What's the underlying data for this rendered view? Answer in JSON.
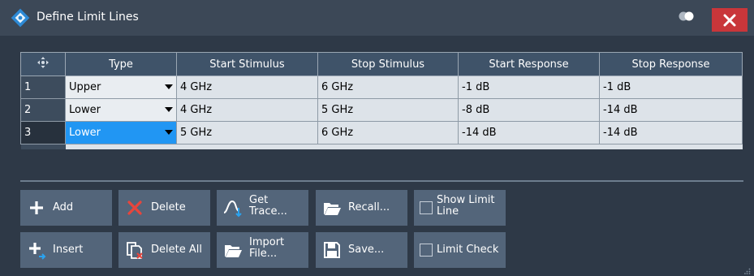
{
  "window": {
    "title": "Define Limit Lines"
  },
  "table": {
    "columns": [
      "Type",
      "Start Stimulus",
      "Stop Stimulus",
      "Start Response",
      "Stop Response"
    ],
    "rows": [
      {
        "num": "1",
        "type": "Upper",
        "start_stimulus": "4 GHz",
        "stop_stimulus": "6 GHz",
        "start_response": "-1 dB",
        "stop_response": "-1 dB"
      },
      {
        "num": "2",
        "type": "Lower",
        "start_stimulus": "4 GHz",
        "stop_stimulus": "5 GHz",
        "start_response": "-8 dB",
        "stop_response": "-14 dB"
      },
      {
        "num": "3",
        "type": "Lower",
        "start_stimulus": "5 GHz",
        "stop_stimulus": "6 GHz",
        "start_response": "-14 dB",
        "stop_response": "-14 dB"
      }
    ]
  },
  "buttons": {
    "add": "Add",
    "insert": "Insert",
    "delete": "Delete",
    "delete_all": "Delete All",
    "get_trace_1": "Get",
    "get_trace_2": "Trace...",
    "import_file_1": "Import",
    "import_file_2": "File...",
    "recall": "Recall...",
    "save": "Save...",
    "show_limit_line_1": "Show Limit",
    "show_limit_line_2": "Line",
    "limit_check": "Limit Check"
  },
  "colors": {
    "accent": "#2196f3",
    "close": "#c9363a",
    "button": "#53657a",
    "header": "#3f5369"
  }
}
